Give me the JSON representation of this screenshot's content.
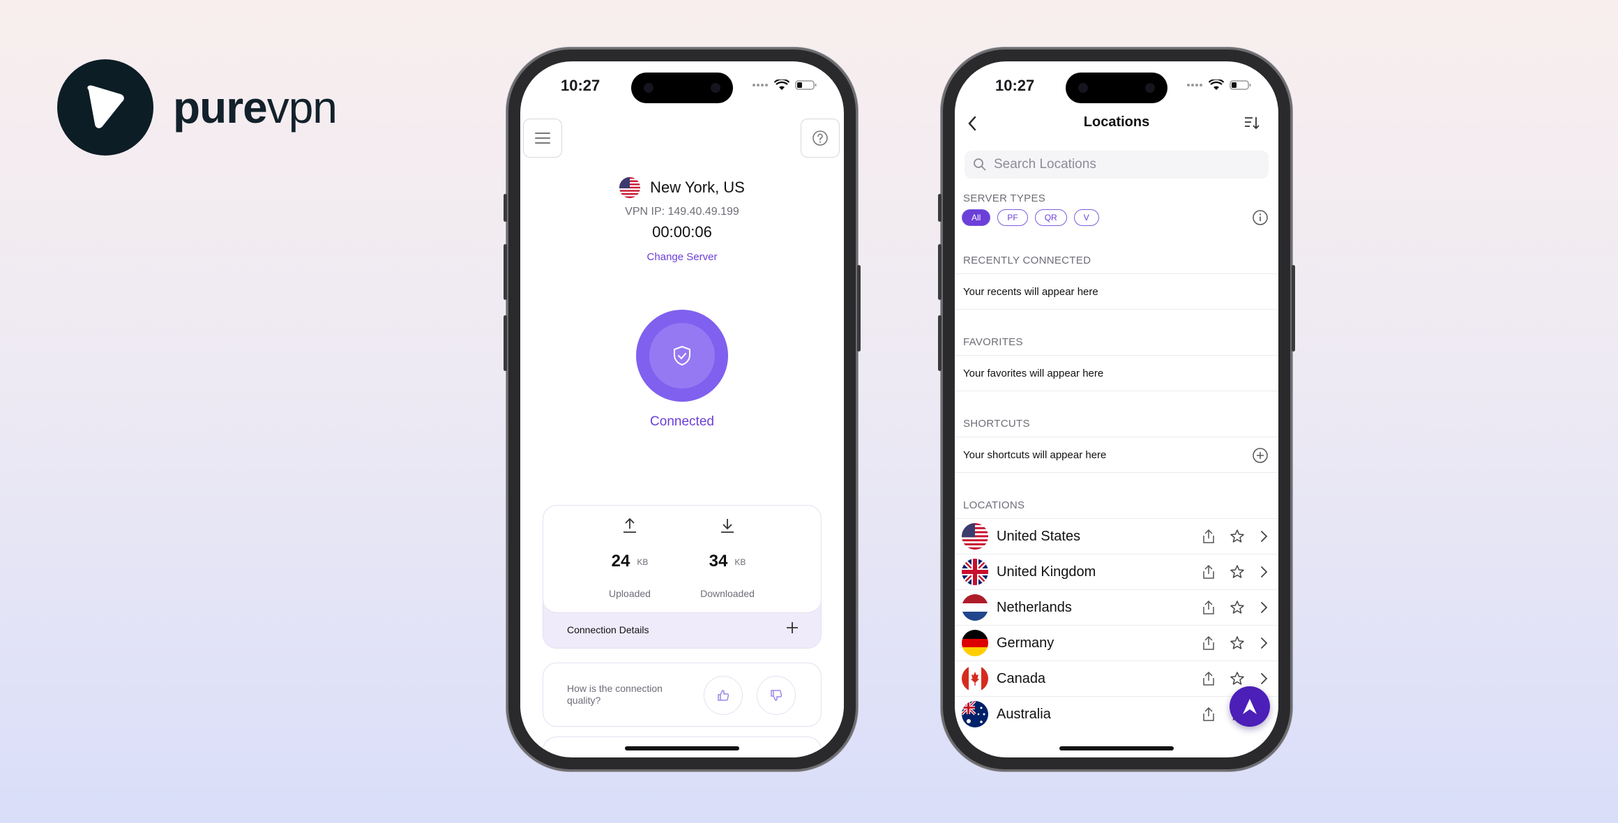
{
  "brand": {
    "word_bold": "pure",
    "word_light": "vpn"
  },
  "colors": {
    "accent": "#6b3fd8",
    "connect_outer": "#8060ee",
    "fab": "#4b1fb8",
    "logo_bg": "#0d1d26"
  },
  "phone1": {
    "status_time": "10:27",
    "location": {
      "flag": "us-flag-icon",
      "name": "New York, US"
    },
    "vpn_ip": "VPN IP: 149.40.49.199",
    "timer": "00:00:06",
    "change_server": "Change Server",
    "status": "Connected",
    "stats": {
      "uploaded": {
        "value": "24",
        "unit": "KB",
        "label": "Uploaded"
      },
      "downloaded": {
        "value": "34",
        "unit": "KB",
        "label": "Downloaded"
      }
    },
    "connection_details": "Connection Details",
    "quality_prompt": "How is the connection quality?"
  },
  "phone2": {
    "status_time": "10:27",
    "title": "Locations",
    "search_placeholder": "Search Locations",
    "server_types_label": "SERVER TYPES",
    "server_types": [
      "All",
      "PF",
      "QR",
      "V"
    ],
    "active_server_type": "All",
    "recent_label": "RECENTLY CONNECTED",
    "recent_empty": "Your recents will appear here",
    "favorites_label": "FAVORITES",
    "favorites_empty": "Your favorites will appear here",
    "shortcuts_label": "SHORTCUTS",
    "shortcuts_empty": "Your shortcuts will appear here",
    "locations_label": "LOCATIONS",
    "countries": [
      {
        "name": "United States",
        "flag": "us-flag-icon"
      },
      {
        "name": "United Kingdom",
        "flag": "uk-flag-icon"
      },
      {
        "name": "Netherlands",
        "flag": "nl-flag-icon"
      },
      {
        "name": "Germany",
        "flag": "de-flag-icon"
      },
      {
        "name": "Canada",
        "flag": "ca-flag-icon"
      },
      {
        "name": "Australia",
        "flag": "au-flag-icon"
      }
    ]
  }
}
